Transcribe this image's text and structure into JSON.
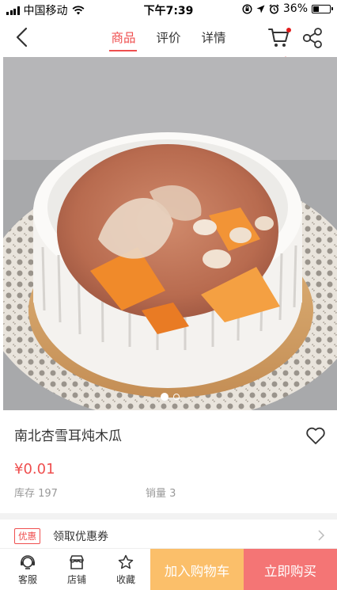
{
  "status_bar": {
    "carrier": "中国移动",
    "time": "下午7:39",
    "battery": "36%",
    "battery_level": 0.36,
    "icons": [
      "signal-icon",
      "wifi-icon",
      "rotation-lock-icon",
      "location-icon",
      "alarm-icon",
      "battery-icon"
    ]
  },
  "nav": {
    "tabs": [
      {
        "label": "商品",
        "active": true
      },
      {
        "label": "评价",
        "active": false
      },
      {
        "label": "详情",
        "active": false
      }
    ],
    "icons": [
      "back-icon",
      "cart-icon",
      "share-icon"
    ]
  },
  "gallery": {
    "image_count": 2,
    "current_index": 0
  },
  "product": {
    "title": "南北杏雪耳炖木瓜",
    "price": "¥0.01",
    "stock": "库存 197",
    "sales": "销量 3"
  },
  "coupon": {
    "badge": "优惠",
    "label": "领取优惠券"
  },
  "bottom_bar": {
    "service": "客服",
    "shop": "店铺",
    "favorite": "收藏",
    "add_to_cart": "加入购物车",
    "buy_now": "立即购买"
  },
  "colors": {
    "accent": "#ef4f4f",
    "add_to_cart_bg": "#fbbf6a",
    "buy_now_bg": "#f47575",
    "annotation_arrow": "#e21b1b"
  }
}
